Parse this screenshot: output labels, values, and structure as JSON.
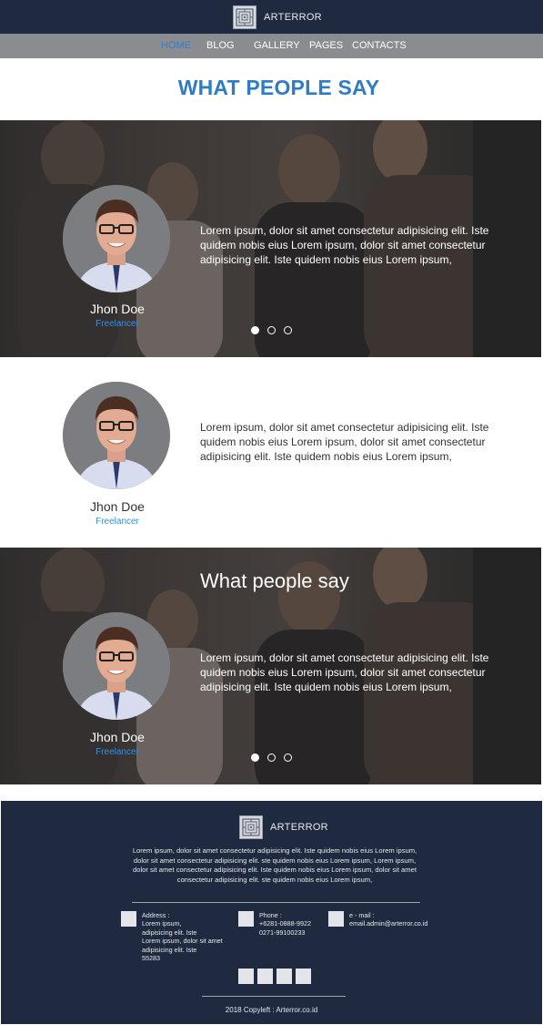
{
  "header": {
    "brand": "ARTERROR",
    "nav": [
      "HOME",
      "BLOG",
      "GALLERY",
      "PAGES",
      "CONTACTS"
    ],
    "active_nav": "HOME"
  },
  "section": {
    "title": "WHAT PEOPLE SAY"
  },
  "testimonials": [
    {
      "name": "Jhon Doe",
      "role": "Freelancer",
      "quote": "Lorem ipsum, dolor sit amet consectetur adipisicing elit. Iste quidem nobis eius Lorem ipsum, dolor sit amet consectetur adipisicing elit. Iste quidem nobis eius Lorem ipsum,",
      "slider_dots": 3,
      "active_dot": 1
    },
    {
      "name": "Jhon Doe",
      "role": "Freelancer",
      "quote": "Lorem ipsum, dolor sit amet consectetur adipisicing elit. Iste quidem nobis eius Lorem ipsum, dolor sit amet consectetur adipisicing elit. Iste quidem nobis eius Lorem ipsum,"
    },
    {
      "title": "What people say",
      "name": "Jhon Doe",
      "role": "Freelancer",
      "quote": "Lorem ipsum, dolor sit amet consectetur adipisicing elit. Iste quidem nobis eius Lorem ipsum, dolor sit amet consectetur adipisicing elit. Iste quidem nobis eius Lorem ipsum,",
      "slider_dots": 3,
      "active_dot": 1
    }
  ],
  "footer": {
    "brand": "ARTERROR",
    "description": "Lorem ipsum, dolor sit amet consectetur adipisicing elit. Iste quidem nobis eius Lorem ipsum, dolor sit amet consectetur adipisicing elit. ste quidem nobis eius Lorem ipsum, Lorem ipsum, dolor sit amet consectetur adipisicing elit. Iste quidem nobis eius Lorem ipsum, dolor sit amet consectetur adipisicing elit. ste quidem nobis eius Lorem ipsum,",
    "contacts": [
      {
        "icon": "location-icon",
        "lines": [
          "Address :",
          "Lorem ipsum,",
          "adipisicing elit. Iste",
          "Lorem ipsum, dolor sit amet",
          "adipisicing elit. Iste",
          "55283"
        ]
      },
      {
        "icon": "phone-icon",
        "lines": [
          "Phone :",
          "+6281-0888-9922",
          "0271-99100233"
        ]
      },
      {
        "icon": "email-icon",
        "lines": [
          "e - mail :",
          "email.admin@arterror.co.id"
        ]
      }
    ],
    "social_icons": [
      "social-icon-1",
      "social-icon-2",
      "social-icon-3",
      "social-icon-4"
    ],
    "copyright": "2018 Copyleft : Arterror.co.id"
  },
  "colors": {
    "header_bg": "#1f2940",
    "nav_bg": "#8a8c8f",
    "accent": "#2e7cc7",
    "footer_bg": "#1f2940"
  }
}
